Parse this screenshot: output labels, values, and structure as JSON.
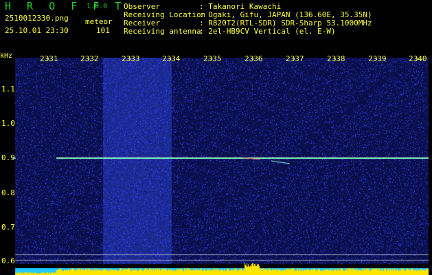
{
  "header": {
    "app_name": "H R O F F T",
    "version": "1.0.0",
    "filename": "2510012330.png",
    "datetime": "25.10.01 23:30",
    "mode_label": "meteor",
    "count": "101",
    "info_labels": [
      "Observer",
      "Receiving Location",
      "Receiver",
      "Receiving antenna"
    ],
    "info_values": [
      ": Takanori Kawachi",
      ": Ogaki, Gifu, JAPAN (136.60E, 35.35N)",
      ": R820T2(RTL-SDR) SDR-Sharp 53.1000MHz",
      ": 2el-HB9CV Vertical (el. E-W)"
    ]
  },
  "spectrogram": {
    "unit_label": "kHz",
    "time_ticks": [
      "2331",
      "2332",
      "2333",
      "2334",
      "2335",
      "2336",
      "2337",
      "2338",
      "2339",
      "2340"
    ],
    "freq_ticks": [
      "1.1",
      "1.0",
      "0.9",
      "0.8",
      "0.7",
      "0.6"
    ],
    "freq_values": [
      1.1,
      1.0,
      0.9,
      0.8,
      0.7,
      0.6
    ],
    "carrier_freq_khz": 0.9,
    "colors": {
      "background": "#0a0f4a",
      "tick_text": "#ffff3c",
      "carrier": "#7dffd0",
      "bright_band": "#1b2a8a",
      "level_bar": "#ffe600",
      "level_base": "#20c8ff"
    }
  }
}
